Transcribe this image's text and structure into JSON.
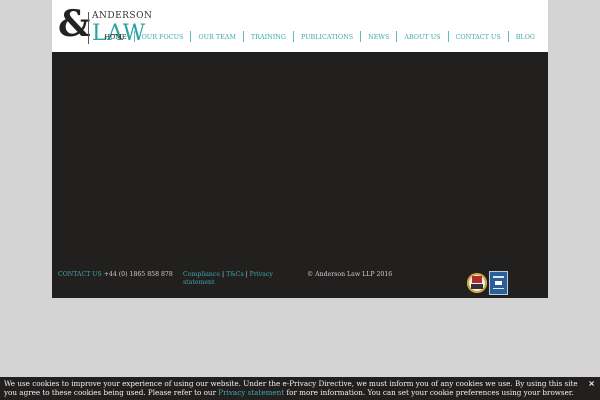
{
  "logo": {
    "ampersand": "&",
    "top_text": "ANDERSON",
    "main_text": "LAW"
  },
  "nav": {
    "items": [
      {
        "label": "HOME"
      },
      {
        "label": "OUR FOCUS"
      },
      {
        "label": "OUR TEAM"
      },
      {
        "label": "TRAINING"
      },
      {
        "label": "PUBLICATIONS"
      },
      {
        "label": "NEWS"
      },
      {
        "label": "ABOUT US"
      },
      {
        "label": "CONTACT US"
      },
      {
        "label": "BLOG"
      }
    ]
  },
  "footer": {
    "contact_label": "CONTACT US",
    "phone": "+44 (0) 1865 858 878",
    "links": {
      "compliance": "Compliance",
      "sep1": "|",
      "tcs": "T&Cs",
      "sep2": "|",
      "privacy": "Privacy statement"
    },
    "copyright": "© Anderson Law LLP 2016"
  },
  "cookie": {
    "text_before": "We use cookies to improve your experience of using our website. Under the e-Privacy Directive, we must inform you of any cookies we use. By using this site you agree to these cookies being used. Please refer to our ",
    "link": "Privacy statement",
    "text_after": " for more information. You can set your cookie preferences using your browser.",
    "close": "×"
  },
  "colors": {
    "accent": "#3ea9a9",
    "dark": "#221f1f",
    "background": "#d4d4d4"
  }
}
